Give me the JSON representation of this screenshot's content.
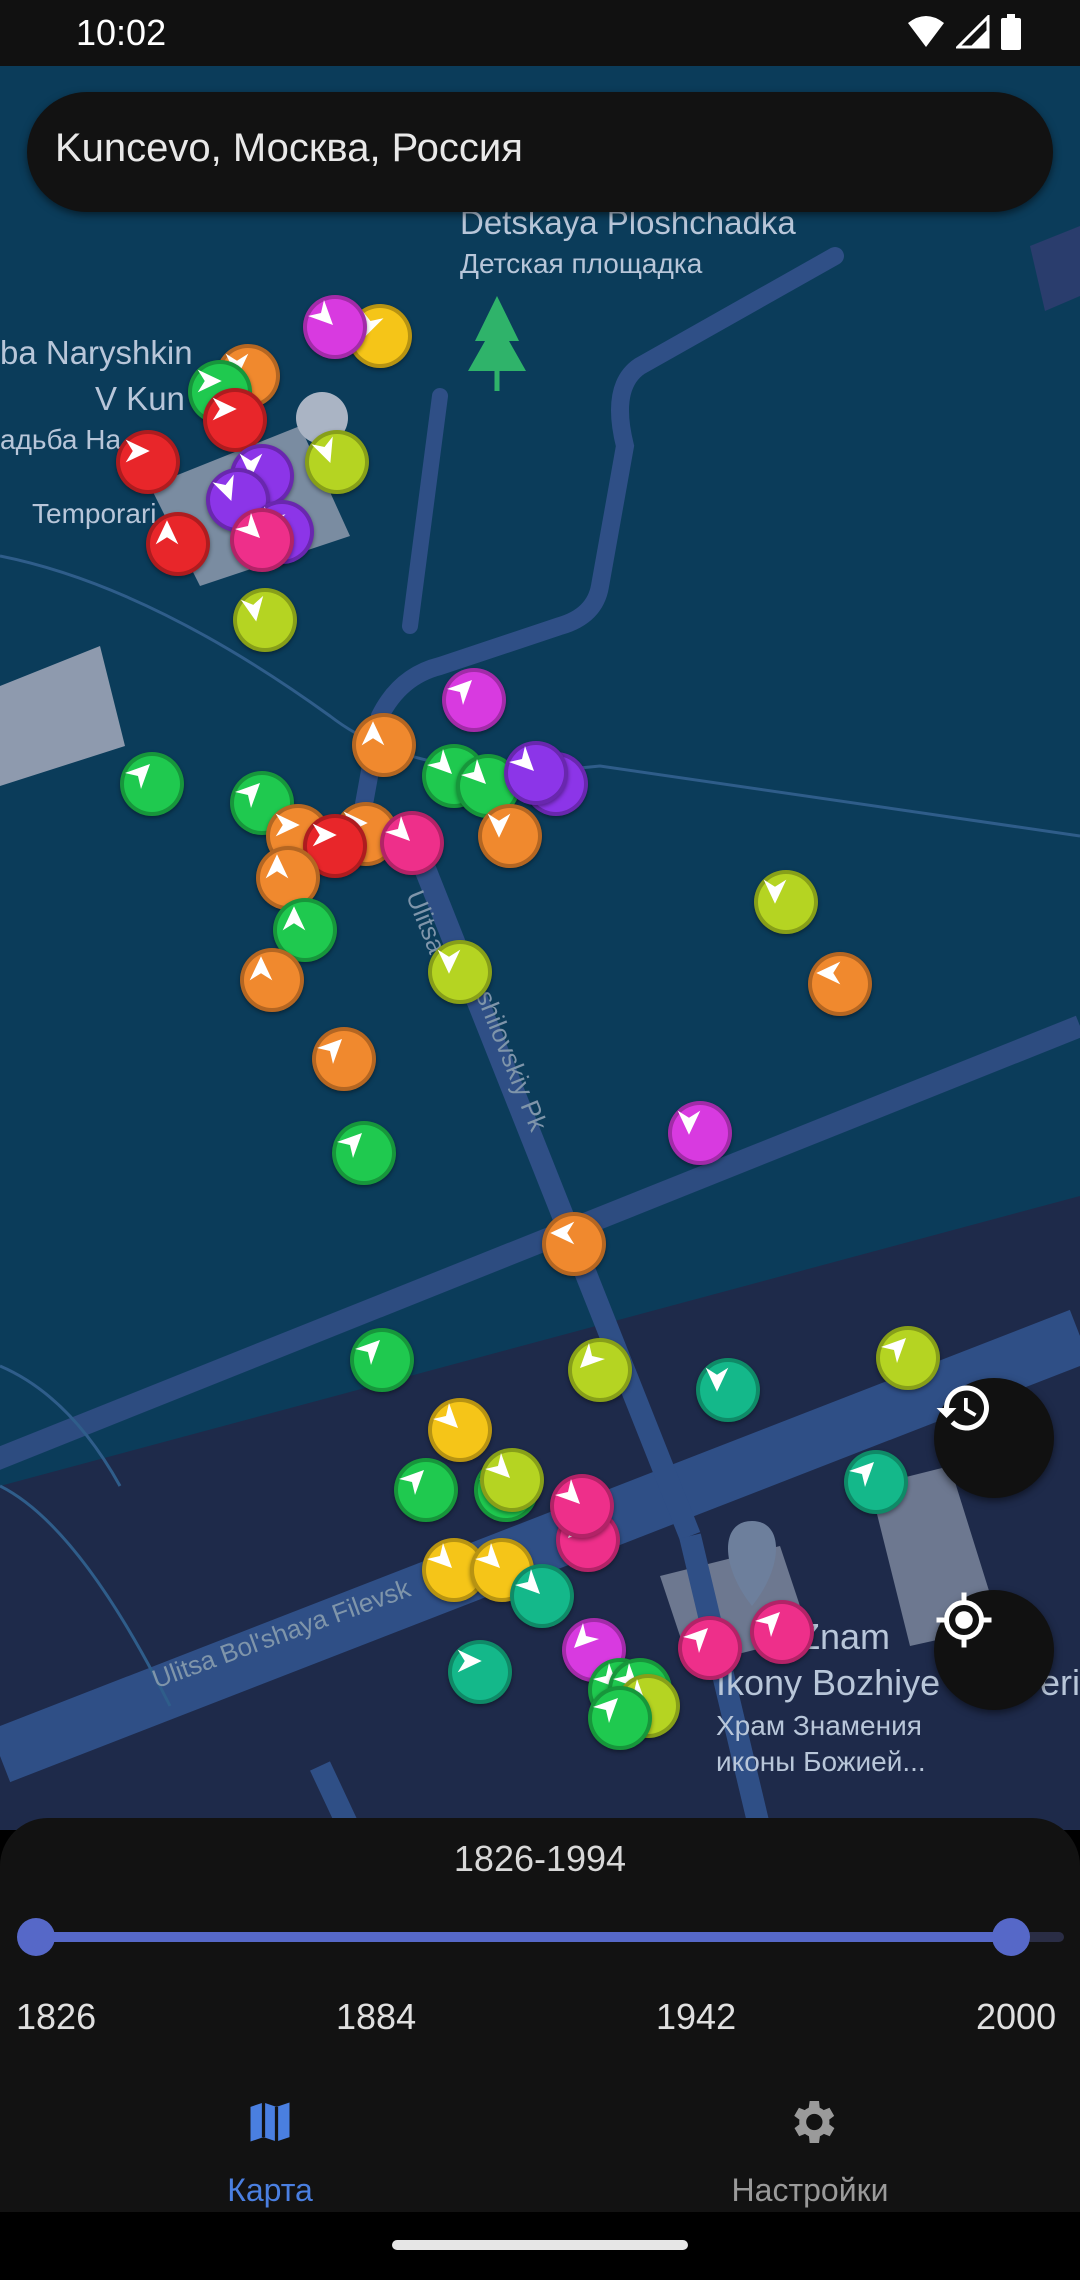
{
  "status_bar": {
    "time": "10:02"
  },
  "search": {
    "text": "Kuncevo, Москва, Россия"
  },
  "map_labels": {
    "park_en": "Detskaya Ploshchadka",
    "park_ru": "Детская площадка",
    "estate_1": "ba Naryshkin",
    "estate_2": "V Kun",
    "estate_3": "адьба На",
    "temporary": "Temporari",
    "street_1": "Ulitsa",
    "street_1b": "shilovskiy Pk",
    "street_2": "Ulitsa Bol'shaya Filevsk",
    "church_en_1": "n Znam",
    "church_en_2": "Ikony Bozhiye",
    "church_en_3": "eri",
    "church_ru_1": "Храм Знамения",
    "church_ru_2": "иконы Божией..."
  },
  "colors": {
    "map_bg": "#0b3c5a",
    "road": "#2f4f86",
    "accent": "#5668c8",
    "marker_red": "#e8262a",
    "marker_orange": "#f0892e",
    "marker_yellow": "#f5c518",
    "marker_lime": "#b5d422",
    "marker_green": "#1fc94f",
    "marker_teal": "#14b88a",
    "marker_magenta": "#d83ae0",
    "marker_pink": "#ee2f8a",
    "marker_purple": "#8c35e8"
  },
  "markers": [
    {
      "color": "magenta",
      "icon": "arrow-icon"
    },
    {
      "color": "yellow",
      "icon": "arrow-icon"
    },
    {
      "color": "orange",
      "icon": "arrow-icon"
    },
    {
      "color": "red",
      "icon": "arrow-icon"
    },
    {
      "color": "lime",
      "icon": "arrow-icon"
    },
    {
      "color": "green",
      "icon": "arrow-icon"
    },
    {
      "color": "purple",
      "icon": "arrow-icon"
    },
    {
      "color": "pink",
      "icon": "arrow-icon"
    },
    {
      "color": "teal",
      "icon": "arrow-icon"
    }
  ],
  "timeline": {
    "range_label": "1826-1994",
    "min": 1826,
    "max": 2000,
    "selected_start": 1826,
    "selected_end": 1994,
    "ticks": [
      "1826",
      "1884",
      "1942",
      "2000"
    ]
  },
  "fabs": {
    "history_icon": "history-icon",
    "location_icon": "my-location-icon"
  },
  "nav": {
    "items": [
      {
        "label": "Карта",
        "icon": "map-icon",
        "active": true
      },
      {
        "label": "Настройки",
        "icon": "gear-icon",
        "active": false
      }
    ]
  }
}
